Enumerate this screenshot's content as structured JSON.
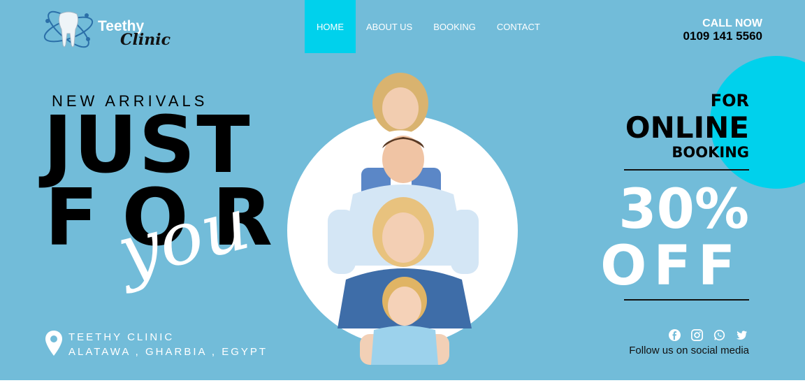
{
  "brand": {
    "name_line1": "Teethy",
    "name_line2": "Clinic",
    "logo_icon": "tooth-orbit-icon"
  },
  "nav": {
    "items": [
      {
        "label": "HOME",
        "active": true
      },
      {
        "label": "ABOUT US",
        "active": false
      },
      {
        "label": "BOOKING",
        "active": false
      },
      {
        "label": "CONTACT",
        "active": false
      }
    ]
  },
  "call": {
    "label": "CALL NOW",
    "number": "0109 141 5560"
  },
  "hero": {
    "tagline": "NEW ARRIVALS",
    "line1": "JUST",
    "line2": "FOR",
    "script": "you",
    "image": "family-stacked-photo"
  },
  "address": {
    "icon": "location-pin-icon",
    "line1": "TEETHY CLINIC",
    "line2": "ALATAWA , GHARBIA , EGYPT"
  },
  "promo": {
    "for": "FOR",
    "online": "ONLINE",
    "booking": "BOOKING",
    "percent": "30%",
    "off": "OFF"
  },
  "social": {
    "icons": [
      "facebook-icon",
      "instagram-icon",
      "whatsapp-icon",
      "twitter-icon"
    ],
    "text": "Follow us on social media"
  },
  "colors": {
    "background": "#72bcd9",
    "accent": "#00d1ec",
    "white": "#ffffff"
  }
}
